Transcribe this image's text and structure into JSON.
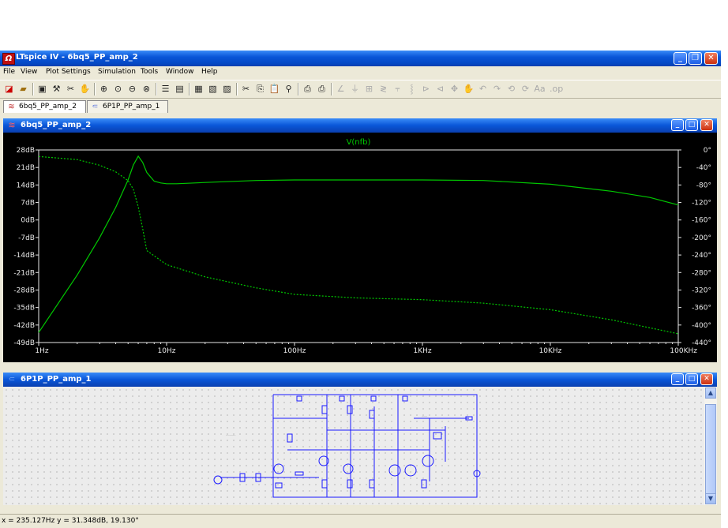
{
  "window": {
    "app_icon_glyph": "Ω",
    "title": "LTspice IV - 6bq5_PP_amp_2"
  },
  "menu": [
    "File",
    "View",
    "Plot Settings",
    "Simulation",
    "Tools",
    "Window",
    "Help"
  ],
  "tabs": [
    {
      "label": "6bq5_PP_amp_2",
      "icon": "waveform-icon",
      "active": true
    },
    {
      "label": "6P1P_PP_amp_1",
      "icon": "schematic-icon",
      "active": false
    }
  ],
  "plot_window": {
    "title": "6bq5_PP_amp_2"
  },
  "schematic_window": {
    "title": "6P1P_PP_amp_1"
  },
  "status": {
    "cursor": "x = 235.127Hz   y = 31.348dB, 19.130°"
  },
  "colors": {
    "trace": "#00c800",
    "plot_bg": "#000000",
    "schematic_wire": "#1a1aff"
  },
  "chart_data": {
    "type": "line",
    "title": "V(nfb)",
    "x_scale": "log",
    "xlim": [
      1,
      100000
    ],
    "x_ticks": [
      "1Hz",
      "10Hz",
      "100Hz",
      "1KHz",
      "10KHz",
      "100KHz"
    ],
    "y_ticks_left": [
      "28dB",
      "21dB",
      "14dB",
      "7dB",
      "0dB",
      "-7dB",
      "-14dB",
      "-21dB",
      "-28dB",
      "-35dB",
      "-42dB",
      "-49dB"
    ],
    "ylim_left": [
      -49,
      28
    ],
    "y_ticks_right": [
      "0°",
      "-40°",
      "-80°",
      "-120°",
      "-160°",
      "-200°",
      "-240°",
      "-280°",
      "-320°",
      "-360°",
      "-400°",
      "-440°"
    ],
    "ylim_right": [
      -440,
      0
    ],
    "grid": false,
    "series": [
      {
        "style": "solid",
        "x": [
          1,
          2,
          3,
          4,
          5,
          5.5,
          6,
          6.5,
          7,
          8,
          9,
          10,
          12,
          20,
          50,
          100,
          1000,
          3000,
          10000,
          30000,
          60000,
          100000
        ],
        "y": [
          -45,
          -22,
          -7,
          5,
          16,
          22,
          25.5,
          23,
          19,
          15.5,
          14.8,
          14.5,
          14.5,
          15,
          15.8,
          16,
          16,
          15.8,
          14.3,
          11.5,
          9,
          6
        ]
      },
      {
        "style": "dashed",
        "x": [
          1,
          2,
          3,
          4,
          5,
          5.5,
          6,
          6.5,
          7,
          10,
          20,
          50,
          100,
          300,
          1000,
          3000,
          10000,
          30000,
          100000
        ],
        "y": [
          -15,
          -22,
          -35,
          -50,
          -70,
          -90,
          -130,
          -180,
          -230,
          -262,
          -290,
          -315,
          -330,
          -338,
          -342,
          -350,
          -365,
          -388,
          -420
        ]
      }
    ]
  }
}
